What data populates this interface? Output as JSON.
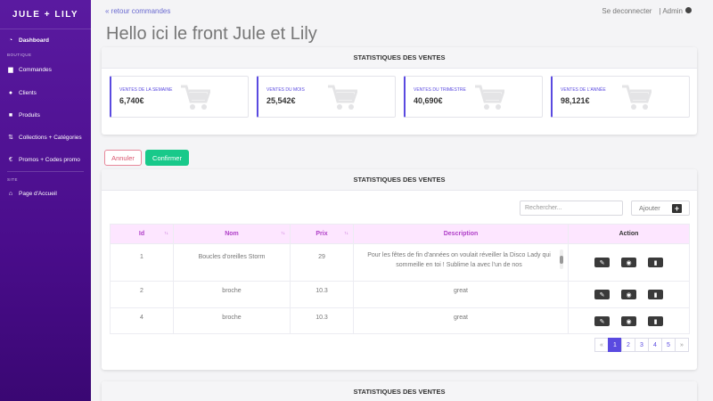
{
  "sidebar": {
    "brand": "JULE + LILY",
    "dashboard": "Dashboard",
    "section_boutique": "BOUTIQUE",
    "items": [
      "Commandes",
      "Clients",
      "Produits",
      "Collections + Catégories",
      "Promos + Codes promo"
    ],
    "section_site": "SITE",
    "site_items": [
      "Page d'Accueil"
    ]
  },
  "header": {
    "back_link": "« retour commandes",
    "logout": "Se deconnecter",
    "admin": "| Admin",
    "title": "Hello ici le front Jule et Lily"
  },
  "stats_card": {
    "title": "STATISTIQUES DES VENTES",
    "stats": [
      {
        "label": "VENTES DE LA SEMAINE",
        "value": "6,740€"
      },
      {
        "label": "VENTES DU MOIS",
        "value": "25,542€"
      },
      {
        "label": "VENTES DU TRIMESTRE",
        "value": "40,690€"
      },
      {
        "label": "VENTES DE L'ANNÉE",
        "value": "98,121€"
      }
    ]
  },
  "buttons": {
    "cancel": "Annuler",
    "confirm": "Confirmer"
  },
  "table_card": {
    "title": "STATISTIQUES DES VENTES",
    "search_placeholder": "Rechercher...",
    "add_label": "Ajouter",
    "columns": [
      "Id",
      "Nom",
      "Prix",
      "Description",
      "Action"
    ],
    "rows": [
      {
        "id": "1",
        "nom": "Boucles d'oreilles Storm",
        "prix": "29",
        "description": "Pour les fêtes de fin d'années on voulait réveiller la Disco Lady qui sommeille en toi ! Sublime la avec l'un de nos"
      },
      {
        "id": "2",
        "nom": "broche",
        "prix": "10.3",
        "description": "great"
      },
      {
        "id": "4",
        "nom": "broche",
        "prix": "10.3",
        "description": "great"
      }
    ],
    "pagination": [
      "«",
      "1",
      "2",
      "3",
      "4",
      "5",
      "»"
    ],
    "current_page": "1"
  },
  "bottom_card": {
    "title": "STATISTIQUES DES VENTES"
  },
  "colors": {
    "accent": "#5a4ae0",
    "sidebar": "#4a0d8c",
    "confirm": "#18c98a",
    "cancel": "#d9566e",
    "table_header": "#fde6ff"
  }
}
